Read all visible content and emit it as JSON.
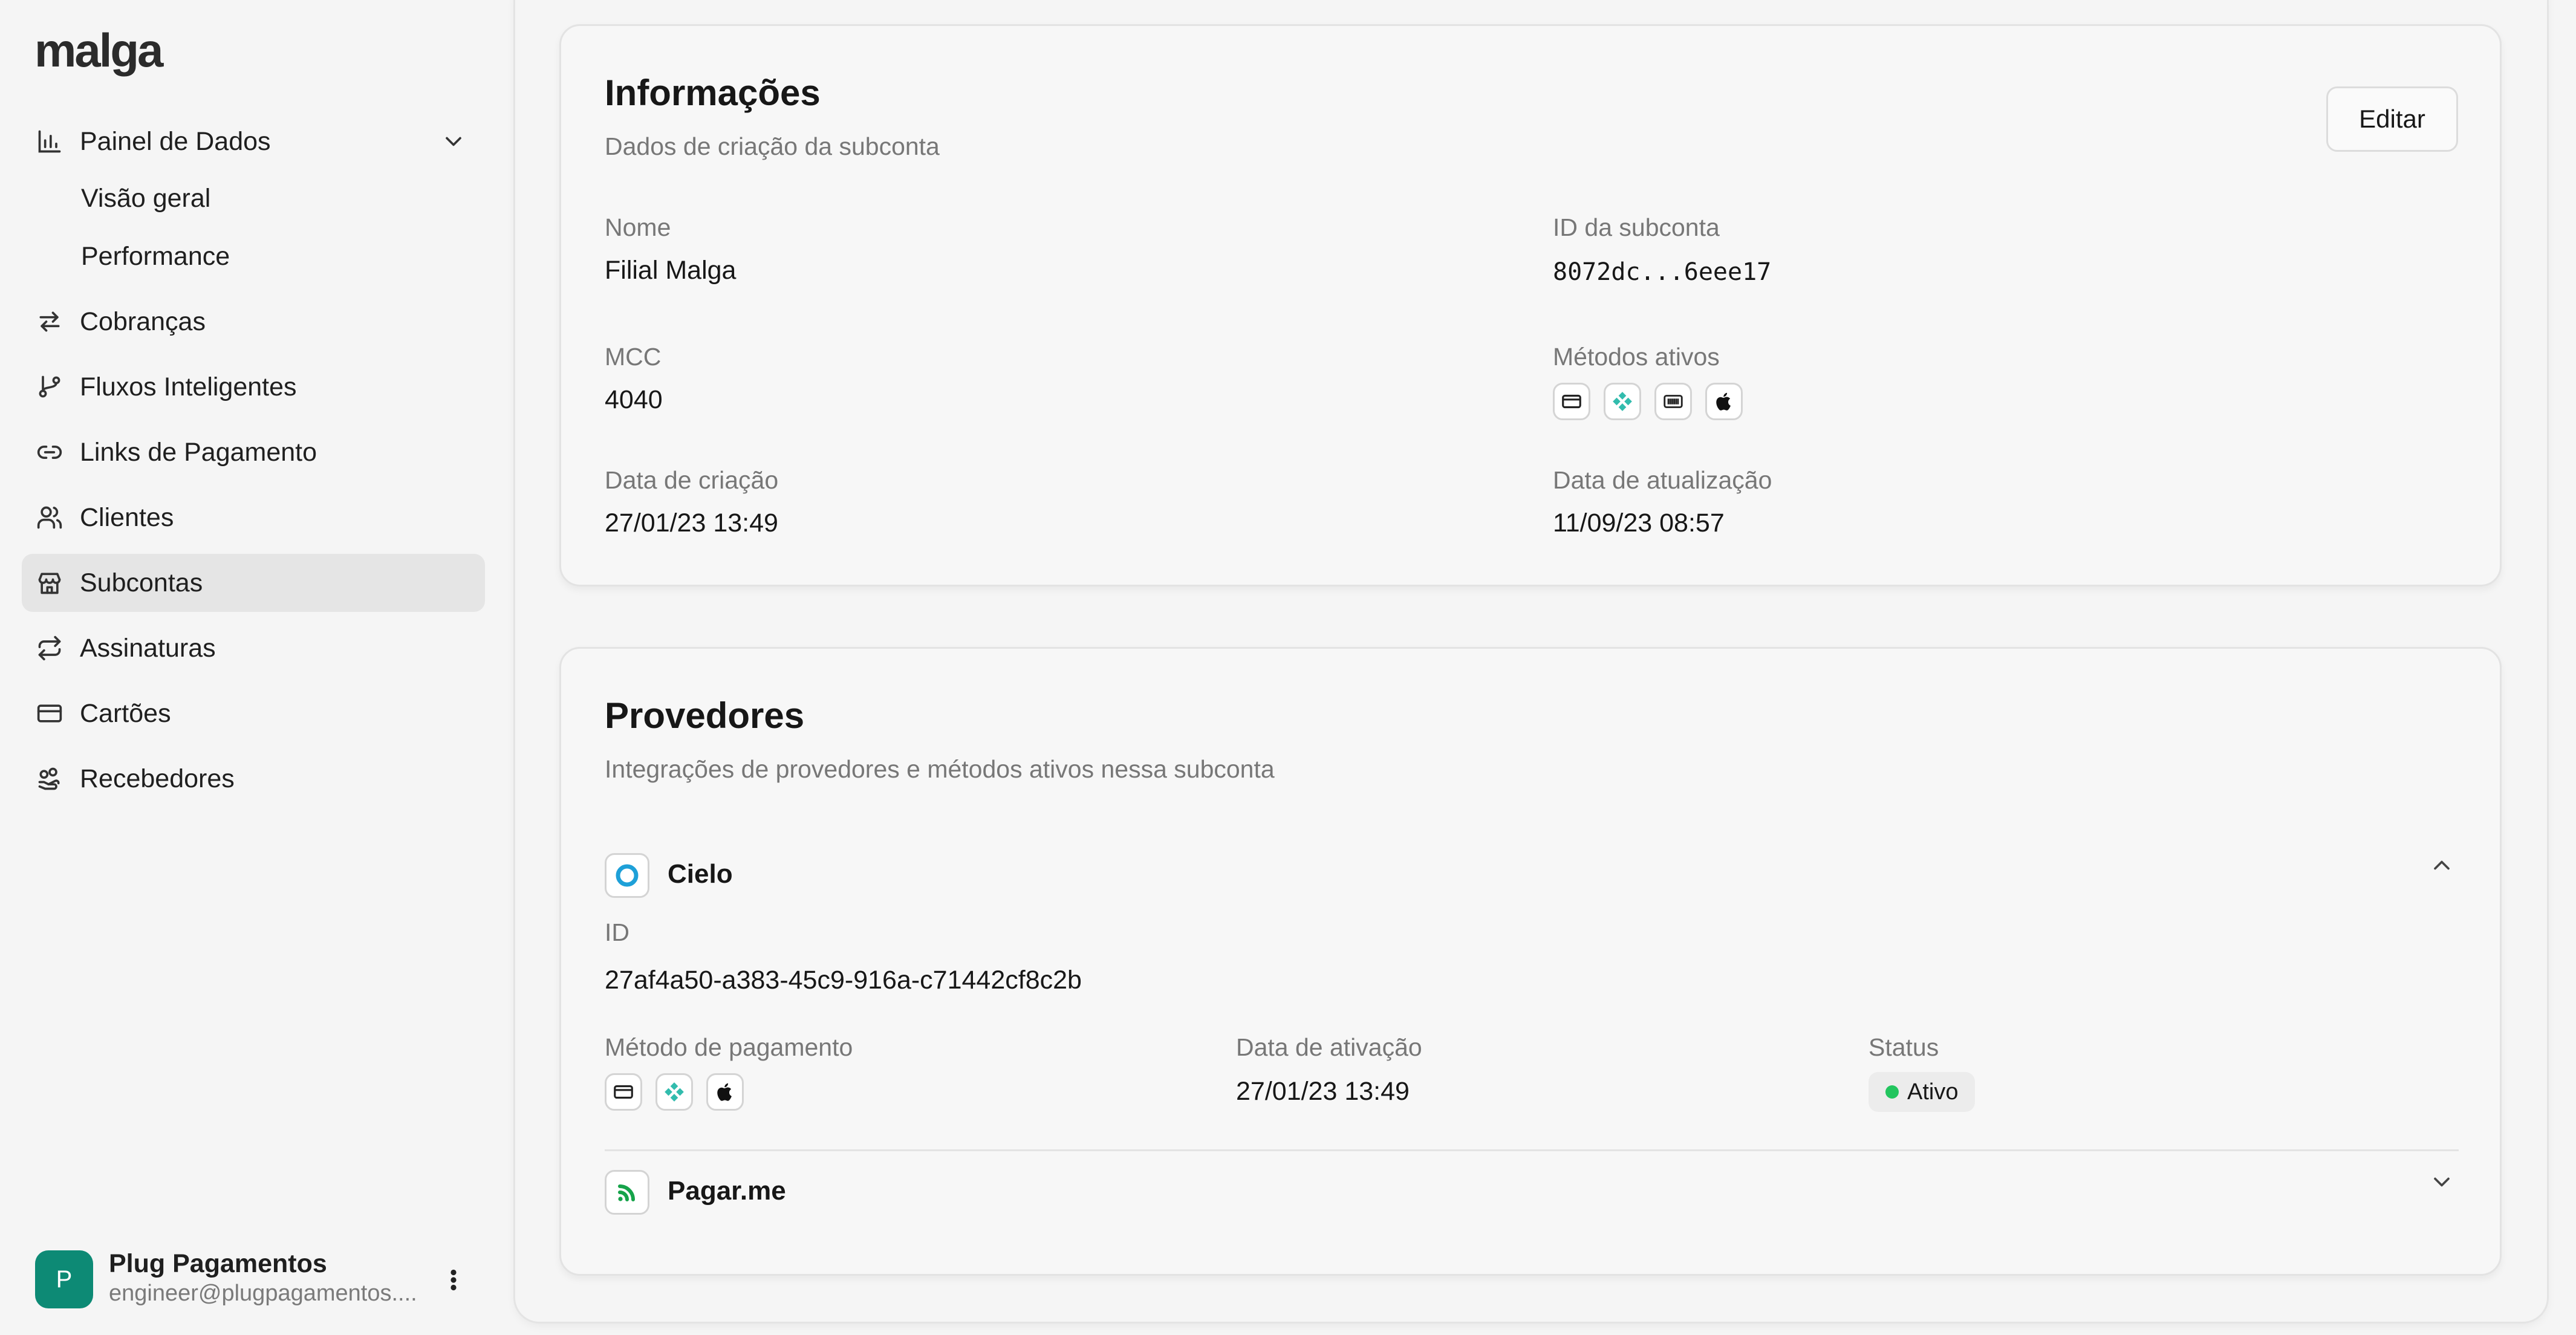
{
  "brand": {
    "logo": "malga"
  },
  "sidebar": {
    "items": [
      {
        "label": "Painel de Dados",
        "icon": "bar-chart-icon"
      },
      {
        "label": "Cobranças",
        "icon": "arrows-exchange-icon"
      },
      {
        "label": "Fluxos Inteligentes",
        "icon": "git-branch-icon"
      },
      {
        "label": "Links de Pagamento",
        "icon": "link-icon"
      },
      {
        "label": "Clientes",
        "icon": "users-icon"
      },
      {
        "label": "Subcontas",
        "icon": "store-icon",
        "active": true
      },
      {
        "label": "Assinaturas",
        "icon": "repeat-icon"
      },
      {
        "label": "Cartões",
        "icon": "credit-card-icon"
      },
      {
        "label": "Recebedores",
        "icon": "hand-coins-icon"
      }
    ],
    "submenu": [
      "Visão geral",
      "Performance"
    ]
  },
  "user": {
    "initial": "P",
    "name": "Plug Pagamentos",
    "email": "engineer@plugpagamentos...."
  },
  "info_card": {
    "title": "Informações",
    "subtitle": "Dados de criação da subconta",
    "edit_label": "Editar",
    "name_label": "Nome",
    "name_value": "Filial Malga",
    "id_label": "ID da subconta",
    "id_value": "8072dc...6eee17",
    "mcc_label": "MCC",
    "mcc_value": "4040",
    "methods_label": "Métodos ativos",
    "created_label": "Data de criação",
    "created_value": "27/01/23 13:49",
    "updated_label": "Data de atualização",
    "updated_value": "11/09/23 08:57"
  },
  "providers_card": {
    "title": "Provedores",
    "subtitle": "Integrações de provedores e métodos ativos nessa subconta",
    "providers": [
      {
        "name": "Cielo",
        "id_label": "ID",
        "id_value": "27af4a50-a383-45c9-916a-c71442cf8c2b",
        "method_label": "Método de pagamento",
        "activation_label": "Data de ativação",
        "activation_value": "27/01/23 13:49",
        "status_label": "Status",
        "status_value": "Ativo",
        "expanded": true
      },
      {
        "name": "Pagar.me",
        "expanded": false
      }
    ]
  },
  "colors": {
    "accent": "#0d8a75",
    "pix": "#32bcad",
    "status_active": "#22c55e"
  }
}
